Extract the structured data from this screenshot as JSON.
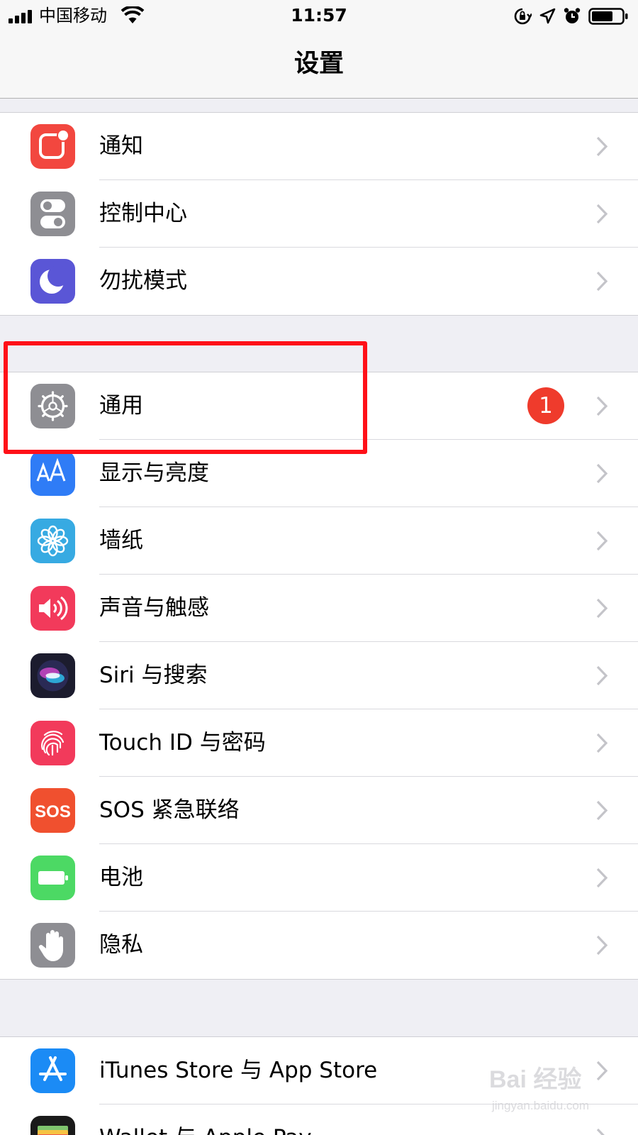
{
  "status_bar": {
    "carrier": "中国移动",
    "time": "11:57"
  },
  "nav": {
    "title": "设置"
  },
  "groups": [
    {
      "items": [
        {
          "label": "通知",
          "icon": "notifications-icon",
          "color": "#f2473f"
        },
        {
          "label": "控制中心",
          "icon": "control-center-icon",
          "color": "#8e8e93"
        },
        {
          "label": "勿扰模式",
          "icon": "moon-icon",
          "color": "#5a56d6"
        }
      ]
    },
    {
      "items": [
        {
          "label": "通用",
          "icon": "gear-icon",
          "color": "#8e8e93",
          "badge": "1",
          "highlighted": true
        },
        {
          "label": "显示与亮度",
          "icon": "display-brightness-icon",
          "color": "#2f7cf6"
        },
        {
          "label": "墙纸",
          "icon": "flower-icon",
          "color": "#37aae2"
        },
        {
          "label": "声音与触感",
          "icon": "speaker-icon",
          "color": "#f23a5b"
        },
        {
          "label": "Siri 与搜索",
          "icon": "siri-icon",
          "color": "#1c1c2e"
        },
        {
          "label": "Touch ID 与密码",
          "icon": "fingerprint-icon",
          "color": "#f23a5b"
        },
        {
          "label": "SOS 紧急联络",
          "icon": "sos-icon",
          "color": "#f0502f",
          "icon_text": "SOS"
        },
        {
          "label": "电池",
          "icon": "battery-icon",
          "color": "#4cd964"
        },
        {
          "label": "隐私",
          "icon": "hand-icon",
          "color": "#8e8e93"
        }
      ]
    },
    {
      "items": [
        {
          "label": "iTunes Store 与 App Store",
          "icon": "app-store-icon",
          "color": "#1b8bf5"
        },
        {
          "label": "Wallet 与 Apple Pay",
          "icon": "wallet-icon",
          "color": "#1a1a1a"
        }
      ]
    }
  ],
  "highlight_color": "#ff1018",
  "watermark": {
    "logo": "Bai 经验",
    "url": "jingyan.baidu.com"
  }
}
